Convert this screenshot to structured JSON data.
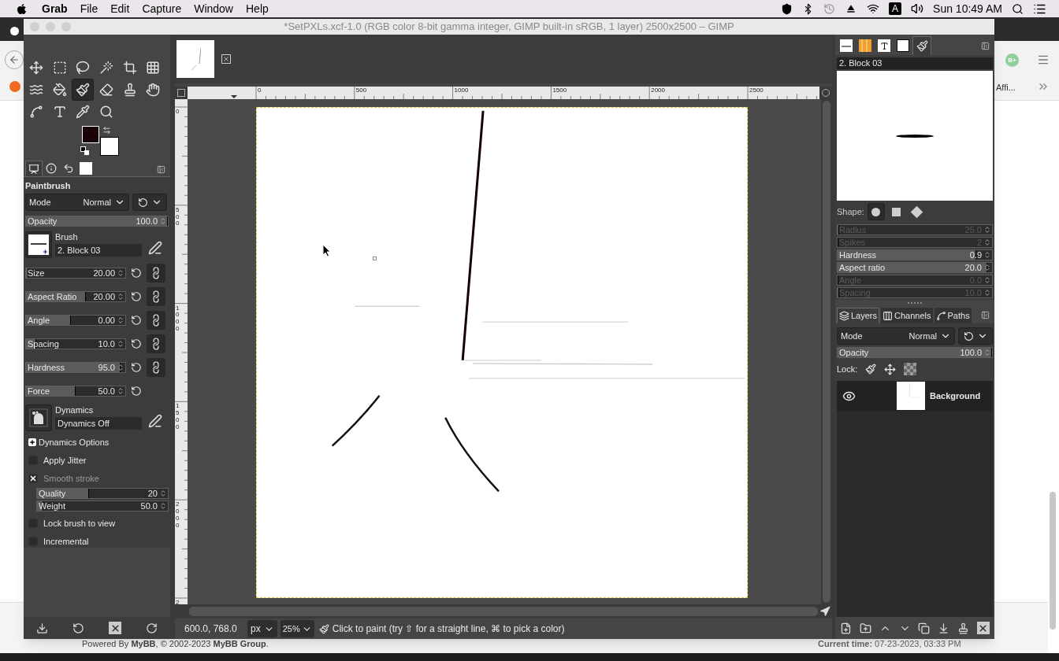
{
  "menubar": {
    "app": "Grab",
    "menus": [
      "File",
      "Edit",
      "Capture",
      "Window",
      "Help"
    ],
    "input_source": "A",
    "clock": "Sun 10:49 AM"
  },
  "browser": {
    "badge": "B+",
    "bookmark": "Affi...",
    "footer_left": "Powered By **MyBB**, © 2002-2023 **MyBB Group**.",
    "footer_right": "**Current time:** 07-23-2023, 03:33 PM"
  },
  "window": {
    "title": "*SetPXLs.xcf-1.0 (RGB color 8-bit gamma integer, GIMP built-in sRGB, 1 layer) 2500x2500 – GIMP"
  },
  "toolbox": {
    "tools": [
      {
        "kind": "move",
        "selected": false
      },
      {
        "kind": "rect-select",
        "selected": false
      },
      {
        "kind": "lasso",
        "selected": false
      },
      {
        "kind": "fuzzy-select",
        "selected": false
      },
      {
        "kind": "crop",
        "selected": false
      },
      {
        "kind": "transform",
        "selected": false
      },
      {
        "kind": "warp",
        "selected": false
      },
      {
        "kind": "bucket",
        "selected": false
      },
      {
        "kind": "paintbrush",
        "selected": true
      },
      {
        "kind": "eraser",
        "selected": false
      },
      {
        "kind": "clone",
        "selected": false
      },
      {
        "kind": "smudge",
        "selected": false
      },
      {
        "kind": "paths",
        "selected": false
      },
      {
        "kind": "text",
        "selected": false
      },
      {
        "kind": "picker",
        "selected": false
      },
      {
        "kind": "zoom",
        "selected": false
      }
    ]
  },
  "tool_options": {
    "tabs": [
      {
        "kind": "tool-options",
        "selected": true
      },
      {
        "kind": "device-status",
        "selected": false
      },
      {
        "kind": "undo-history",
        "selected": false
      },
      {
        "kind": "images",
        "selected": false
      }
    ],
    "title": "Paintbrush",
    "mode": {
      "label": "Mode",
      "value": "Normal"
    },
    "opacity": {
      "label": "Opacity",
      "value": "100.0",
      "level": 1
    },
    "brush": {
      "label": "Brush",
      "name": "2. Block 03"
    },
    "sliders": [
      {
        "label": "Size",
        "value": "20.00",
        "level": 0.02,
        "chain": true
      },
      {
        "label": "Aspect Ratio",
        "value": "20.00",
        "level": 0.6,
        "chain": true
      },
      {
        "label": "Angle",
        "value": "0.00",
        "level": 0.45,
        "chain": true
      },
      {
        "label": "Spacing",
        "value": "10.0",
        "level": 0.1,
        "chain": true
      },
      {
        "label": "Hardness",
        "value": "95.0",
        "level": 0.95,
        "chain": true
      },
      {
        "label": "Force",
        "value": "50.0",
        "level": 0.5,
        "chain": false
      }
    ],
    "dynamics": {
      "label": "Dynamics",
      "name": "Dynamics Off"
    },
    "expander": {
      "label": "Dynamics Options",
      "expanded": false
    },
    "checks": [
      {
        "label": "Apply Jitter",
        "checked": false,
        "disabled": false
      },
      {
        "label": "Smooth stroke",
        "checked": true,
        "disabled": true,
        "sliders": [
          {
            "label": "Quality",
            "value": "20",
            "level": 0.4
          },
          {
            "label": "Weight",
            "value": "50.0",
            "level": 0.05
          }
        ]
      },
      {
        "label": "Lock brush to view",
        "checked": false,
        "disabled": false
      },
      {
        "label": "Incremental",
        "checked": false,
        "disabled": false
      }
    ]
  },
  "rulers": {
    "horizontal": [
      "0",
      "500",
      "1000",
      "1500",
      "2000",
      "2500"
    ],
    "vertical": [
      "0",
      "500",
      "1000",
      "1500",
      "2000",
      "2"
    ]
  },
  "status": {
    "coords": "600.0, 768.0",
    "unit": "px",
    "zoom": "25%",
    "message": "Click to paint (try ⇧ for a straight line, ⌘ to pick a color)"
  },
  "dock": {
    "tabs": [
      {
        "kind": "brushes",
        "selected": false
      },
      {
        "kind": "gradients",
        "selected": false
      },
      {
        "kind": "fonts",
        "selected": false
      },
      {
        "kind": "patterns",
        "selected": false
      },
      {
        "kind": "brush-editor",
        "selected": true
      }
    ],
    "brush_name": "2. Block 03",
    "shape_label": "Shape:",
    "shapes": [
      {
        "kind": "circle",
        "selected": true
      },
      {
        "kind": "square",
        "selected": false
      },
      {
        "kind": "diamond",
        "selected": false
      }
    ],
    "params": [
      {
        "label": "Radius",
        "value": "25.0",
        "level": 0.01,
        "disabled": true
      },
      {
        "label": "Spikes",
        "value": "2",
        "level": 0,
        "disabled": true
      },
      {
        "label": "Hardness",
        "value": "0.9",
        "level": 0.9,
        "disabled": false
      },
      {
        "label": "Aspect ratio",
        "value": "20.0",
        "level": 0.97,
        "disabled": false
      },
      {
        "label": "Angle",
        "value": "0.0",
        "level": 0,
        "disabled": true
      },
      {
        "label": "Spacing",
        "value": "10.0",
        "level": 0.01,
        "disabled": true
      }
    ]
  },
  "layers_panel": {
    "tabs": [
      {
        "label": "Layers",
        "kind": "layers",
        "selected": true
      },
      {
        "label": "Channels",
        "kind": "channels",
        "selected": false
      },
      {
        "label": "Paths",
        "kind": "paths",
        "selected": false
      }
    ],
    "mode": {
      "label": "Mode",
      "value": "Normal"
    },
    "opacity": {
      "label": "Opacity",
      "value": "100.0",
      "level": 1
    },
    "lock_label": "Lock:",
    "layers": [
      {
        "name": "Background",
        "visible": true
      }
    ]
  }
}
